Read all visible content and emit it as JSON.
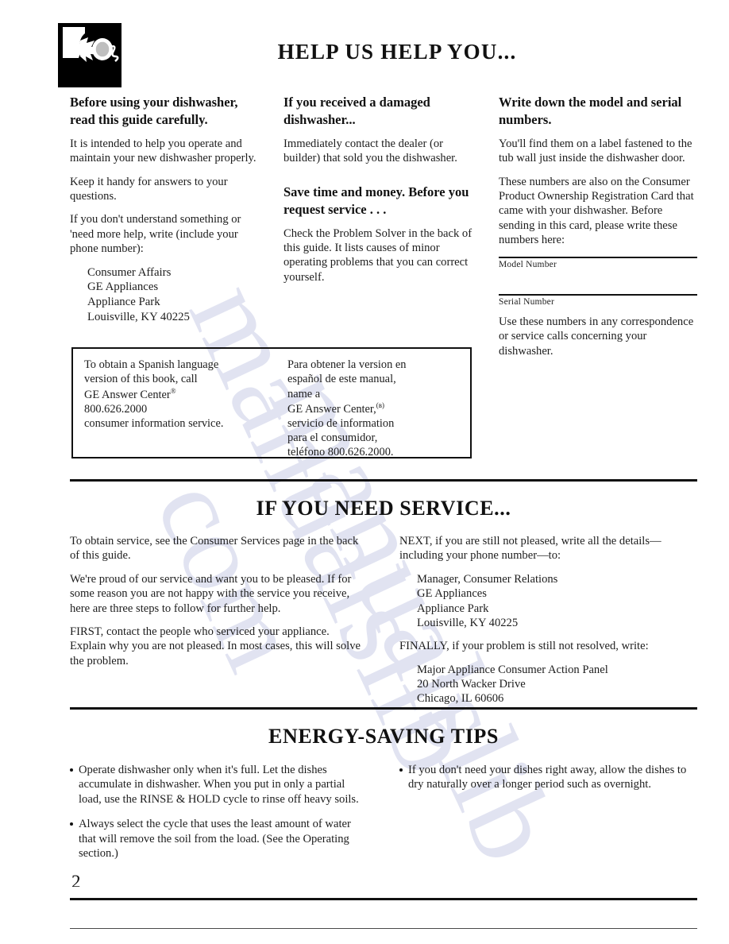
{
  "page": {
    "number": "2",
    "title": "HELP US HELP YOU...",
    "icon_name": "telephone-handset-icon"
  },
  "help_section": {
    "column_left": {
      "heading": "Before using your dishwasher, read this guide carefully.",
      "paragraphs": [
        "It is intended to help you operate and maintain your new dishwasher properly.",
        "Keep it handy for answers to your questions.",
        "If you don't understand something or 'need more help, write (include your phone number):"
      ],
      "address": [
        "Consumer Affairs",
        "GE Appliances",
        "Appliance Park",
        "Louisville, KY 40225"
      ]
    },
    "column_middle": {
      "heading_1": "If you received a damaged dishwasher...",
      "paragraph_1": "Immediately contact the dealer (or builder) that sold you the dishwasher.",
      "heading_2": "Save time and money. Before you request service . . .",
      "paragraph_2": "Check the Problem Solver in the back of this guide. It lists causes of minor operating problems that you can correct yourself."
    },
    "column_right": {
      "heading": "Write down the model and serial numbers.",
      "paragraph_1": "You'll find them on a label fastened to the tub wall just inside the dishwasher door.",
      "paragraph_2": "These numbers are also on the Consumer Product Ownership Registration Card that came with your dishwasher. Before sending in this card, please write these numbers here:",
      "field_model_label": "Model Number",
      "field_serial_label": "Serial Number",
      "paragraph_3": "Use these numbers in any correspondence or service calls concerning your dishwasher."
    }
  },
  "spanish_box": {
    "english": [
      "To obtain a Spanish language",
      "version of this book, call",
      "GE Answer Center",
      "800.626.2000",
      "consumer information service."
    ],
    "english_superscript": "®",
    "spanish": [
      "Para obtener la version en",
      "español de este manual,",
      "name a",
      "GE Answer Center,",
      "servicio de information",
      "para el consumidor,",
      "teléfono  800.626.2000."
    ],
    "spanish_superscript": "(ʙ)"
  },
  "service_section": {
    "title": "IF YOU NEED SERVICE...",
    "left_paragraphs": [
      "To obtain service, see the Consumer Services page in the back of this guide.",
      "We're proud of our service and want you to be pleased. If for some reason you are not happy with the service you receive, here are three steps to follow for further   help.",
      "FIRST, contact the people who serviced your appliance. Explain why you are not pleased. In most cases, this will solve the problem."
    ],
    "right_intro": "NEXT, if you are still not pleased, write all the details—including your phone number—to:",
    "right_address_1": [
      "Manager,  Consumer  Relations",
      "GE Appliances",
      "Appliance Park",
      "Louisville, KY 40225"
    ],
    "right_finally": "FINALLY, if your problem is still not resolved, write:",
    "right_address_2": [
      "Major Appliance Consumer Action Panel",
      "20 North Wacker Drive",
      "Chicago, IL 60606"
    ]
  },
  "energy_section": {
    "title": "ENERGY-SAVING TIPS",
    "left_tips": [
      "Operate dishwasher only when it's full. Let the dishes accumulate in dishwasher. When you put in only a partial load, use the RINSE & HOLD cycle to rinse off heavy soils.",
      "Always select the cycle that uses the least amount of water that will remove the soil from the load. (See the Operating section.)"
    ],
    "right_tips": [
      "If you don't need your dishes right away, allow the dishes to dry naturally over a longer period such as overnight."
    ]
  },
  "watermark": {
    "line_1": "manualslib",
    "line_2": "manualslib",
    "line_3": "com"
  }
}
